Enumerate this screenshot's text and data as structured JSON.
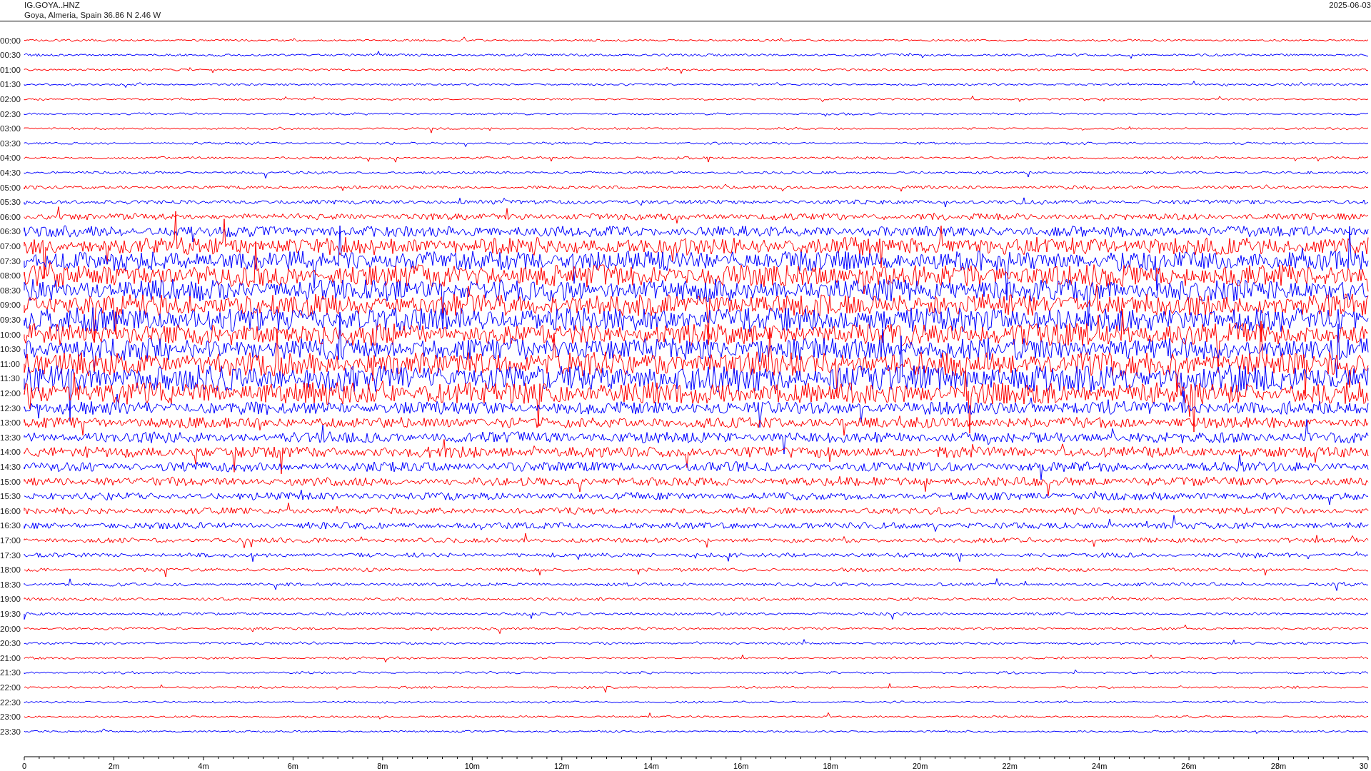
{
  "header": {
    "station": "IG.GOYA..HNZ",
    "location": "Goya, Almeria, Spain  36.86 N 2.46 W",
    "date": "2025-06-03"
  },
  "rows": [
    {
      "label": "00:00",
      "color": "#ff0000"
    },
    {
      "label": "00:30",
      "color": "#0000ff"
    },
    {
      "label": "01:00",
      "color": "#ff0000"
    },
    {
      "label": "01:30",
      "color": "#0000ff"
    },
    {
      "label": "02:00",
      "color": "#ff0000"
    },
    {
      "label": "02:30",
      "color": "#0000ff"
    },
    {
      "label": "03:00",
      "color": "#ff0000"
    },
    {
      "label": "03:30",
      "color": "#0000ff"
    },
    {
      "label": "04:00",
      "color": "#ff0000"
    },
    {
      "label": "04:30",
      "color": "#0000ff"
    },
    {
      "label": "05:00",
      "color": "#ff0000"
    },
    {
      "label": "05:30",
      "color": "#0000ff"
    },
    {
      "label": "06:00",
      "color": "#ff0000"
    },
    {
      "label": "06:30",
      "color": "#0000ff"
    },
    {
      "label": "07:00",
      "color": "#ff0000"
    },
    {
      "label": "07:30",
      "color": "#0000ff"
    },
    {
      "label": "08:00",
      "color": "#ff0000"
    },
    {
      "label": "08:30",
      "color": "#0000ff"
    },
    {
      "label": "09:00",
      "color": "#ff0000"
    },
    {
      "label": "09:30",
      "color": "#0000ff"
    },
    {
      "label": "10:00",
      "color": "#ff0000"
    },
    {
      "label": "10:30",
      "color": "#0000ff"
    },
    {
      "label": "11:00",
      "color": "#ff0000"
    },
    {
      "label": "11:30",
      "color": "#0000ff"
    },
    {
      "label": "12:00",
      "color": "#ff0000"
    },
    {
      "label": "12:30",
      "color": "#0000ff"
    },
    {
      "label": "13:00",
      "color": "#ff0000"
    },
    {
      "label": "13:30",
      "color": "#0000ff"
    },
    {
      "label": "14:00",
      "color": "#ff0000"
    },
    {
      "label": "14:30",
      "color": "#0000ff"
    },
    {
      "label": "15:00",
      "color": "#ff0000"
    },
    {
      "label": "15:30",
      "color": "#0000ff"
    },
    {
      "label": "16:00",
      "color": "#ff0000"
    },
    {
      "label": "16:30",
      "color": "#0000ff"
    },
    {
      "label": "17:00",
      "color": "#ff0000"
    },
    {
      "label": "17:30",
      "color": "#0000ff"
    },
    {
      "label": "18:00",
      "color": "#ff0000"
    },
    {
      "label": "18:30",
      "color": "#0000ff"
    },
    {
      "label": "19:00",
      "color": "#ff0000"
    },
    {
      "label": "19:30",
      "color": "#0000ff"
    },
    {
      "label": "20:00",
      "color": "#ff0000"
    },
    {
      "label": "20:30",
      "color": "#0000ff"
    },
    {
      "label": "21:00",
      "color": "#ff0000"
    },
    {
      "label": "21:30",
      "color": "#0000ff"
    },
    {
      "label": "22:00",
      "color": "#ff0000"
    },
    {
      "label": "22:30",
      "color": "#0000ff"
    },
    {
      "label": "23:00",
      "color": "#ff0000"
    },
    {
      "label": "23:30",
      "color": "#0000ff"
    }
  ],
  "x_axis": {
    "ticks": [
      "0",
      "2m",
      "4m",
      "6m",
      "8m",
      "10m",
      "12m",
      "14m",
      "16m",
      "18m",
      "20m",
      "22m",
      "24m",
      "26m",
      "28m",
      "30"
    ]
  }
}
